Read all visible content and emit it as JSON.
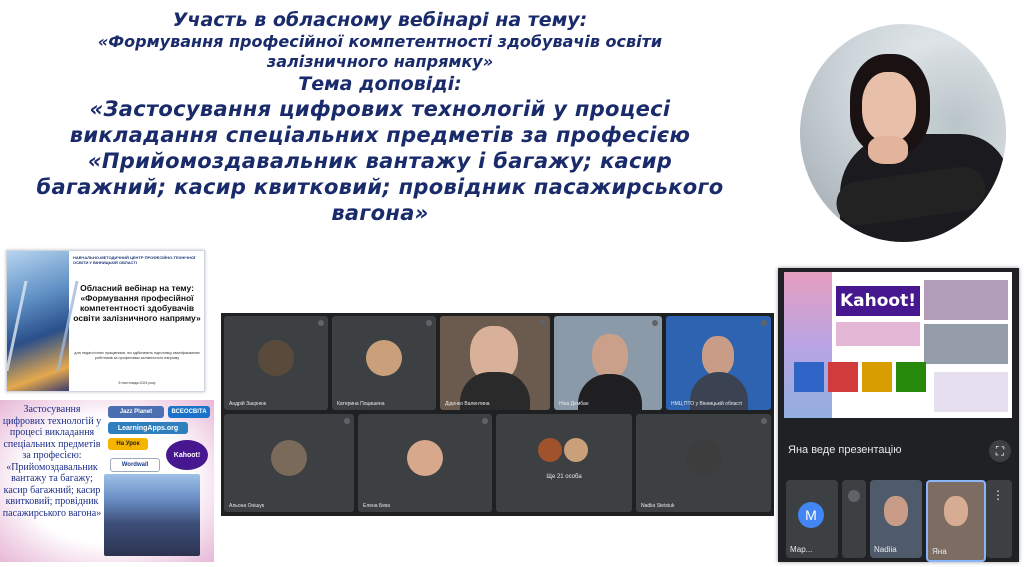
{
  "heading": {
    "line1": "Участь в обласному вебінарі на тему:",
    "line2a": "«Формування професійної компетентності здобувачів освіти",
    "line2b": "залізничного напрямку»",
    "line3": "Тема доповіді:",
    "line4a": "«Застосування цифрових технологій у процесі",
    "line4b": "викладання спеціальних предметів за професією",
    "line4c": "«Прийомоздавальник вантажу і багажу; касир",
    "line4d": "багажний; касир квитковий; провідник пасажирського",
    "line4e": "вагона»"
  },
  "webinar_card": {
    "org": "НАВЧАЛЬНО-МЕТОДИЧНИЙ ЦЕНТР ПРОФЕСІЙНО-ТЕХНІЧНОЇ ОСВІТИ У ВІННИЦЬКІЙ ОБЛАСТІ",
    "title": "Обласний вебінар на тему: «Формування професійної компетентності здобувачів освіти залізничного напряму»",
    "desc": "для педагогічних працівників, які здійснюють підготовку кваліфікованих робітників за професіями залізничного напряму",
    "date": "6 листопада 2024 року"
  },
  "topic_card": {
    "text": "Застосування цифрових технологій у процесі викладання спеціальних предметів за професією: «Прийомоздавальник вантажу та багажу; касир багажний; касир квитковий; провідник пасажирського вагона»",
    "tiles": {
      "jazz": "Jazz Planet",
      "vseosvita": "ВСЕОСВІТА",
      "learning": "LearningApps.org",
      "naurok": "На Урок",
      "kahoot": "Kahoot!",
      "wordwall": "Wordwall"
    }
  },
  "meet": {
    "tiles": [
      {
        "name": "Андрій Заєрнюк"
      },
      {
        "name": "Катерина Поцишена"
      },
      {
        "name": "Діденко Валентина"
      },
      {
        "name": "Ніна Дембан"
      },
      {
        "name": "НМЦ ПТО у Вінницькій області"
      },
      {
        "name": "Альона Онішук"
      },
      {
        "name": "Елена Бевз"
      },
      {
        "name": "Ще 21 особа"
      },
      {
        "name": "Nadiia Stetsiuk"
      }
    ]
  },
  "kahoot_panel": {
    "logo": "Kahoot!",
    "presenting": "Яна веде презентацію",
    "participants": [
      {
        "name": "Мар..."
      },
      {
        "name": "Nadiia"
      },
      {
        "name": "Яна"
      }
    ],
    "avatar_letter": "M"
  }
}
